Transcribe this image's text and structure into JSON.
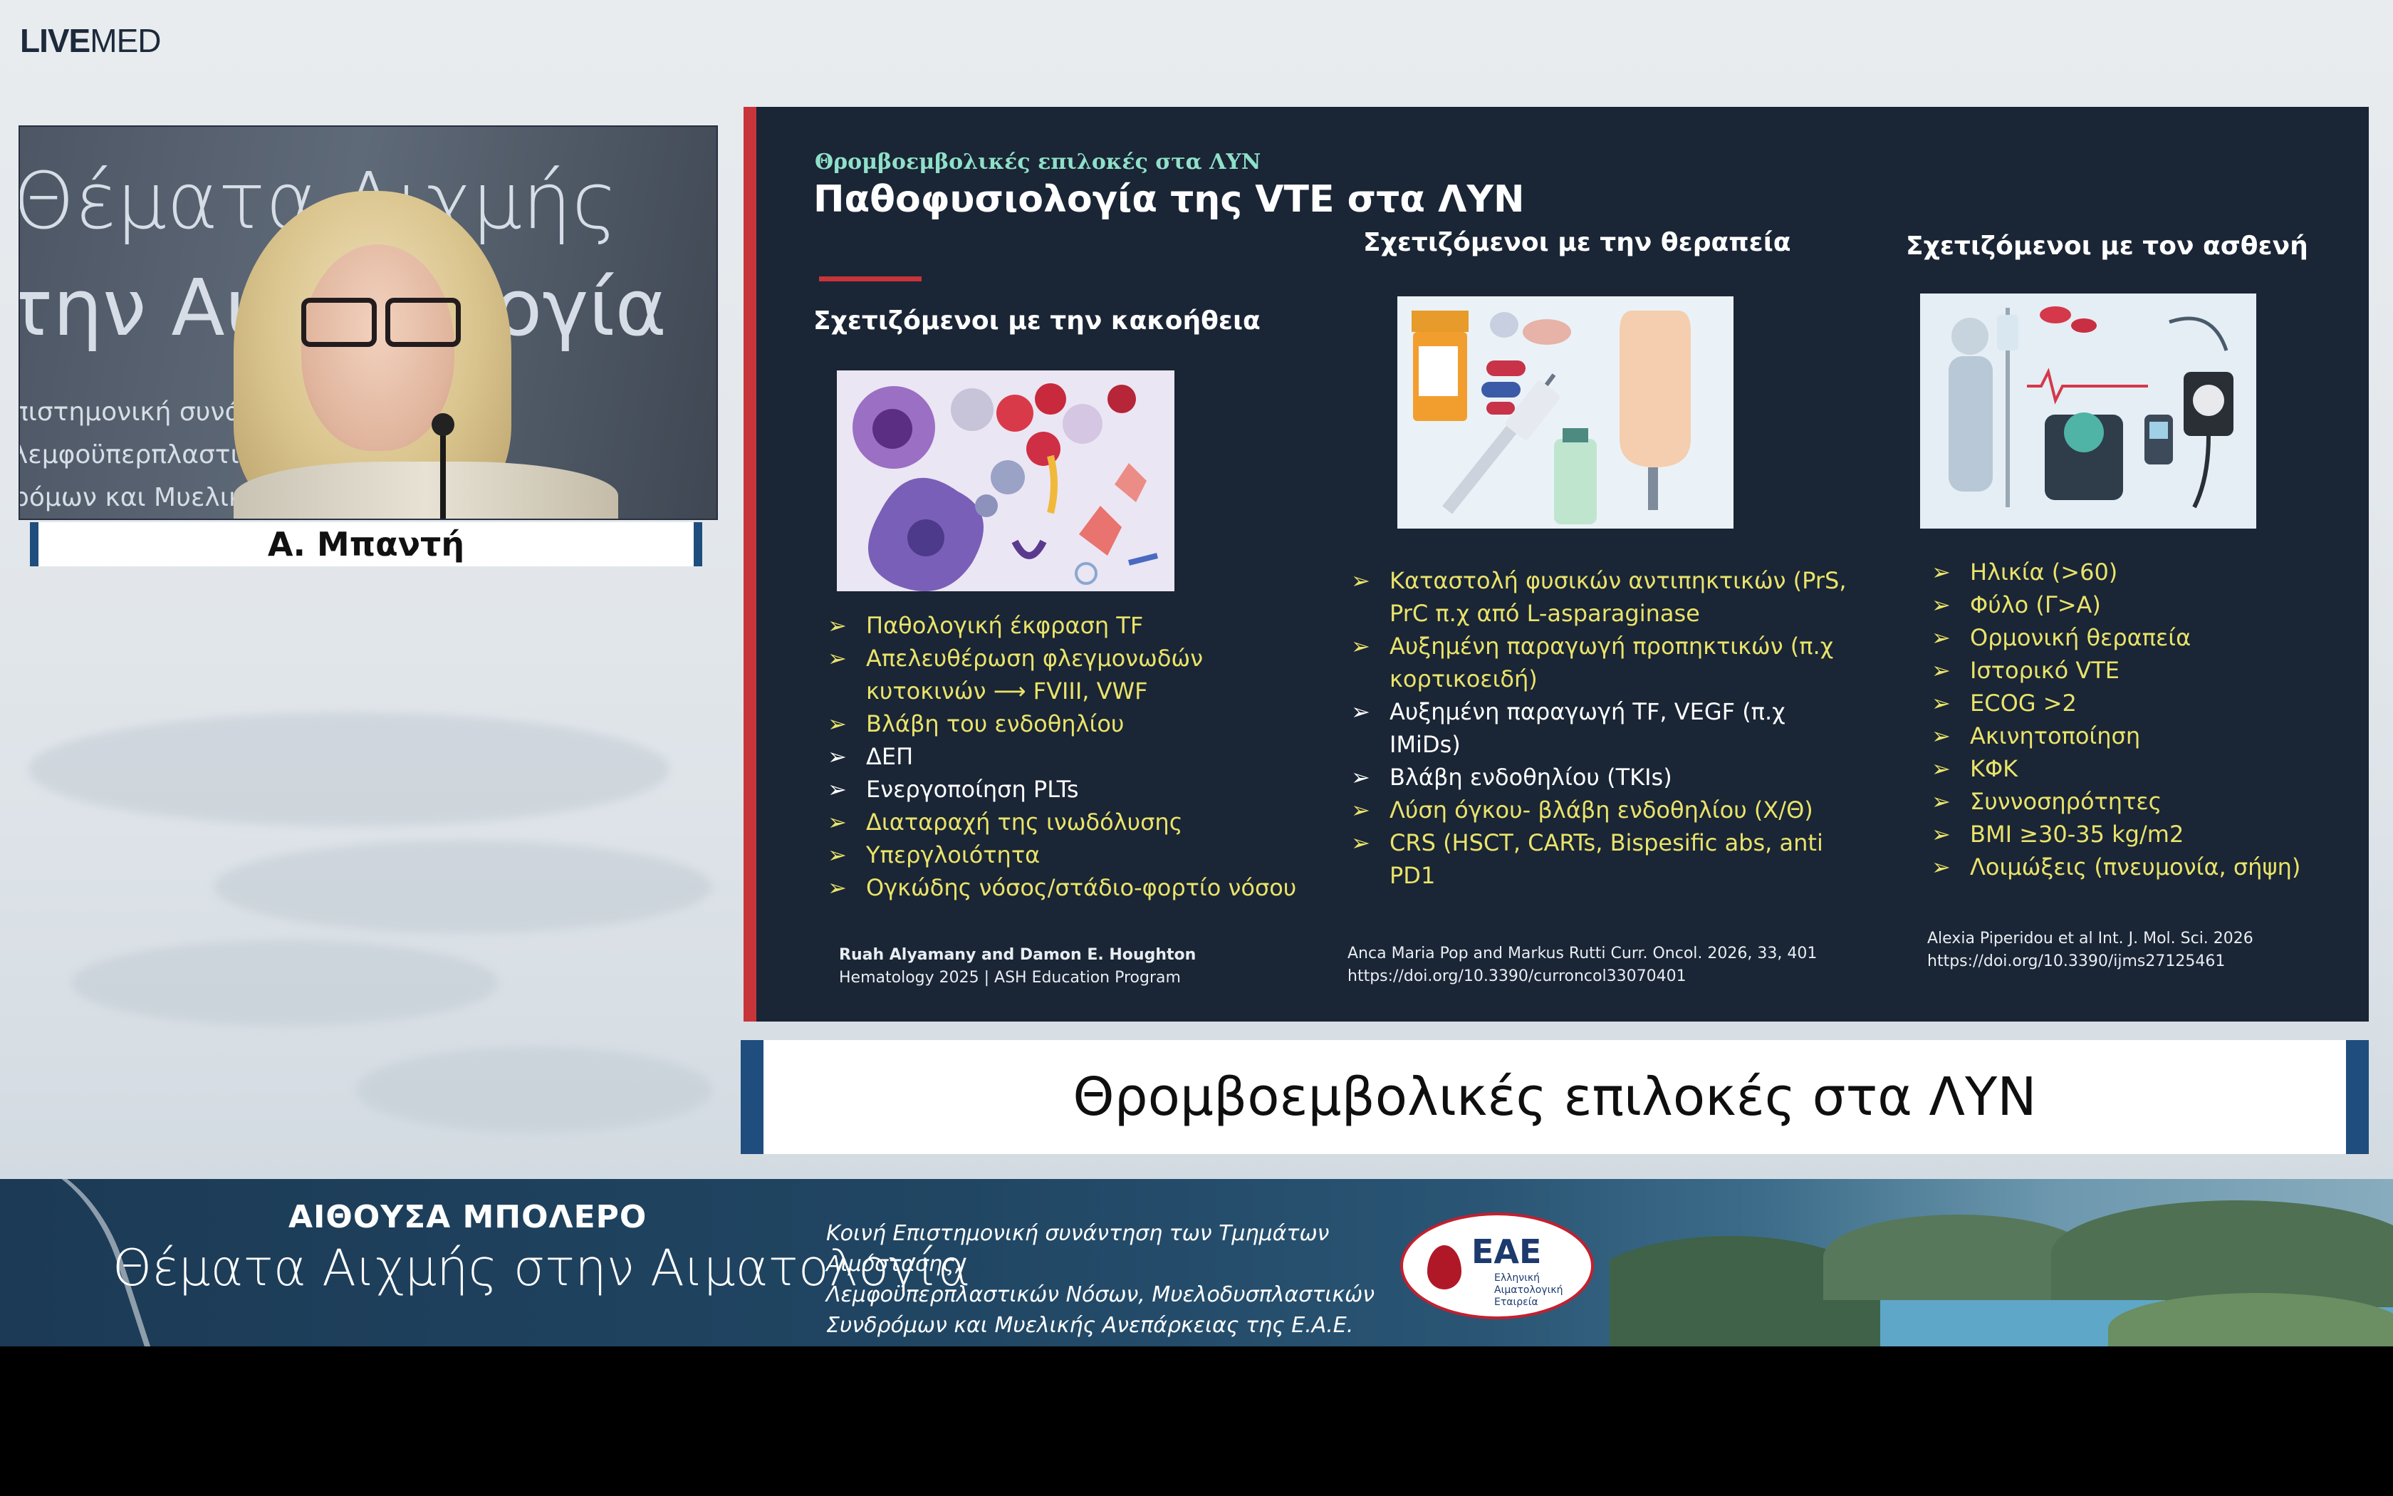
{
  "brand": {
    "bold": "LIVE",
    "regular": "MED"
  },
  "video": {
    "backdrop_lines": [
      "Θέματα Αιχμής",
      "την Αιματολογία",
      "πιστημονική συνάντηση",
      "λεμφοϋπερπλαστικών Νόσων",
      "ρόμων και Μυελικής"
    ],
    "speaker_name": "Α. Μπαντή"
  },
  "slide": {
    "subtitle": "Θρομβοεμβολικές επιλοκές στα ΛΥΝ",
    "title": "Παθοφυσιολογία της VTE στα ΛΥΝ",
    "columns": [
      {
        "heading": "Σχετιζόμενοι  με την  κακοήθεια",
        "image_icon": "cells-illustration-icon",
        "points": [
          {
            "text": "Παθολογική έκφραση TF",
            "color": "yellow"
          },
          {
            "text": "Απελευθέρωση φλεγμονωδών",
            "color": "yellow"
          },
          {
            "text": "κυτοκινών ⟶ FVIII, VWF",
            "color": "yellow",
            "continuation": true
          },
          {
            "text": "Βλάβη του ενδοθηλίου",
            "color": "yellow"
          },
          {
            "text": "ΔΕΠ",
            "color": "white"
          },
          {
            "text": "Ενεργοποίηση PLTs",
            "color": "white"
          },
          {
            "text": "Διαταραχή της ινωδόλυσης",
            "color": "yellow"
          },
          {
            "text": "Υπεργλοιότητα",
            "color": "yellow"
          },
          {
            "text": "Ογκώδης νόσος/στάδιο-φορτίο νόσου",
            "color": "yellow"
          }
        ],
        "reference": [
          "Ruah Alyamany and Damon E. Houghton",
          "Hematology 2025 | ASH Education Program"
        ]
      },
      {
        "heading": "Σχετιζόμενοι  με την θεραπεία",
        "image_icon": "medication-illustration-icon",
        "points": [
          {
            "text": "Καταστολή φυσικών αντιπηκτικών (PrS,",
            "color": "yellow"
          },
          {
            "text": "PrC π.χ από L-asparaginase",
            "color": "yellow",
            "continuation": true
          },
          {
            "text": "Αυξημένη παραγωγή προπηκτικών (π.χ",
            "color": "yellow"
          },
          {
            "text": "κορτικοειδή)",
            "color": "yellow",
            "continuation": true
          },
          {
            "text": "Αυξημένη παραγωγή TF, VEGF (π.χ",
            "color": "white"
          },
          {
            "text": "IMiDs)",
            "color": "white",
            "continuation": true
          },
          {
            "text": "Βλάβη ενδοθηλίου (TKIs)",
            "color": "white"
          },
          {
            "text": "Λύση όγκου- βλάβη ενδοθηλίου (Χ/Θ)",
            "color": "yellow"
          },
          {
            "text": "CRS (HSCT, CARTs, Bispesific abs, anti PD1",
            "color": "yellow"
          }
        ],
        "reference": [
          "Anca Maria Pop  and Markus Rutti Curr. Oncol. 2026, 33, 401",
          "https://doi.org/10.3390/curroncol33070401"
        ]
      },
      {
        "heading": "Σχετιζόμενοι  με τον ασθενή",
        "image_icon": "patient-illustration-icon",
        "points": [
          {
            "text": "Ηλικία  (>60)",
            "color": "yellow"
          },
          {
            "text": "Φύλο (Γ>Α)",
            "color": "yellow"
          },
          {
            "text": "Ορμονική θεραπεία",
            "color": "yellow"
          },
          {
            "text": "Ιστορικό VTE",
            "color": "yellow"
          },
          {
            "text": "ECOG >2",
            "color": "yellow"
          },
          {
            "text": "Ακινητοποίηση",
            "color": "yellow"
          },
          {
            "text": "ΚΦΚ",
            "color": "yellow"
          },
          {
            "text": "Συννοσηρότητες",
            "color": "yellow"
          },
          {
            "text": "BMI ≥30-35 kg/m2",
            "color": "yellow"
          },
          {
            "text": "Λοιμώξεις (πνευμονία, σήψη)",
            "color": "yellow"
          }
        ],
        "reference": [
          "Alexia Piperidou et al Int. J. Mol. Sci. 2026",
          "https://doi.org/10.3390/ijms27125461"
        ]
      }
    ]
  },
  "caption": "Θρομβοεμβολικές επιλοκές στα ΛΥΝ",
  "banner": {
    "hall": "ΑΙΘΟΥΣΑ ΜΠΟΛΕΡΟ",
    "topic": "Θέματα Αιχμής στην Αιματολογία",
    "description": [
      "Κοινή Επιστημονική συνάντηση των Τμημάτων Αιμόστασης,",
      "Λεμφοϋπερπλαστικών Νόσων, Μυελοδυσπλαστικών",
      "Συνδρόμων και Μυελικής Ανεπάρκειας της Ε.Α.Ε."
    ],
    "logo_text": "ΕΑΕ",
    "logo_sub": [
      "Ελληνική",
      "Αιματολογική",
      "Εταιρεία"
    ]
  },
  "colors": {
    "accent_red": "#c7343a",
    "slide_bg": "#1a2535",
    "bullet_yellow": "#e9e36a",
    "frame_blue": "#1f4d7d"
  }
}
